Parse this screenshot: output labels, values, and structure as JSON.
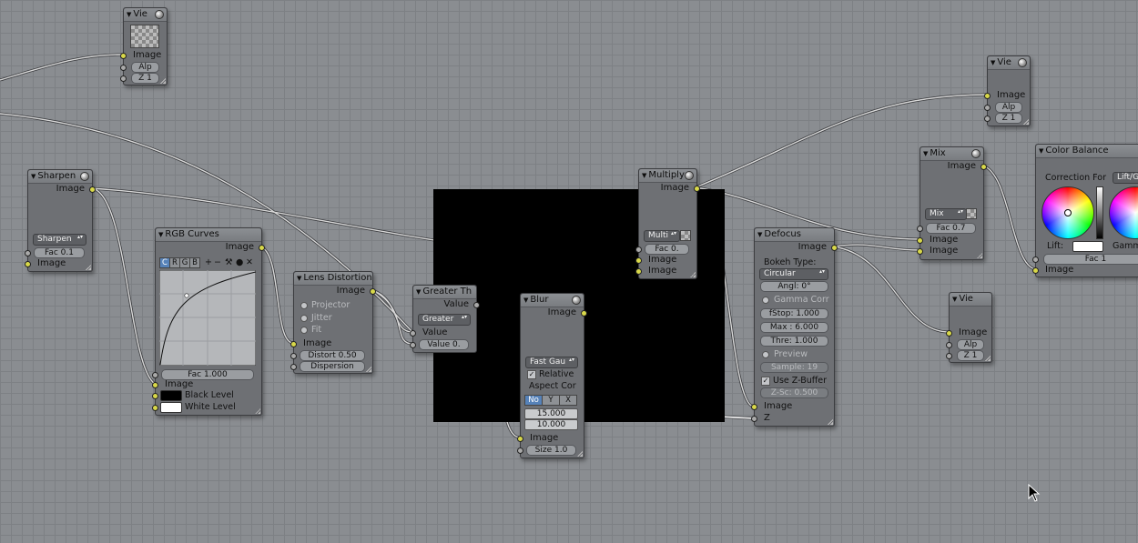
{
  "nodes": {
    "viewer_top": {
      "title": "Vie",
      "in_image": "Image",
      "alpha": "Alp",
      "z": "Z 1"
    },
    "viewer_right_top": {
      "title": "Vie",
      "in_image": "Image",
      "alpha": "Alp",
      "z": "Z 1"
    },
    "viewer_right_bottom": {
      "title": "Vie",
      "in_image": "Image",
      "alpha": "Alp",
      "z": "Z 1"
    },
    "sharpen": {
      "title": "Sharpen",
      "out_image": "Image",
      "filter": "Sharpen",
      "fac": "Fac 0.1",
      "in_image": "Image"
    },
    "rgb_curves": {
      "title": "RGB Curves",
      "out_image": "Image",
      "channels": [
        "C",
        "R",
        "G",
        "B"
      ],
      "fac": "Fac 1.000",
      "in_image": "Image",
      "black_level": "Black Level",
      "white_level": "White Level"
    },
    "lens_distortion": {
      "title": "Lens Distortion",
      "out_image": "Image",
      "projector": "Projector",
      "jitter": "Jitter",
      "fit": "Fit",
      "in_image": "Image",
      "distort": "Distort 0.50",
      "dispersion": "Dispersion"
    },
    "greater_than": {
      "title": "Greater Th",
      "out_value": "Value",
      "operation": "Greater",
      "in_value": "Value",
      "in_value2": "Value 0."
    },
    "blur": {
      "title": "Blur",
      "out_image": "Image",
      "filter": "Fast Gau",
      "relative": "Relative",
      "aspect": "Aspect Cor",
      "aspect_options": [
        "No",
        "Y",
        "X"
      ],
      "size_x": "15.000",
      "size_y": "10.000",
      "in_image": "Image",
      "size": "Size 1.0"
    },
    "multiply": {
      "title": "Multiply",
      "out_image": "Image",
      "mode": "Multi",
      "fac": "Fac 0.",
      "in_image1": "Image",
      "in_image2": "Image"
    },
    "mix": {
      "title": "Mix",
      "out_image": "Image",
      "mode": "Mix",
      "fac": "Fac 0.7",
      "in_image1": "Image",
      "in_image2": "Image"
    },
    "defocus": {
      "title": "Defocus",
      "out_image": "Image",
      "bokeh_label": "Bokeh Type:",
      "bokeh": "Circular",
      "angle": "Angl: 0°",
      "gamma": "Gamma Corr",
      "fstop": "fStop: 1.000",
      "max": "Max : 6.000",
      "thresh": "Thre: 1.000",
      "preview": "Preview",
      "samples": "Sample: 19",
      "zbuffer": "Use Z-Buffer",
      "zscale": "Z-Sc: 0.500",
      "in_image": "Image",
      "in_z": "Z"
    },
    "color_balance": {
      "title": "Color Balance",
      "correction_label": "Correction For",
      "correction": "Lift/Ga",
      "lift": "Lift:",
      "gamma": "Gamm",
      "fac": "Fac 1",
      "in_image": "Image"
    }
  }
}
